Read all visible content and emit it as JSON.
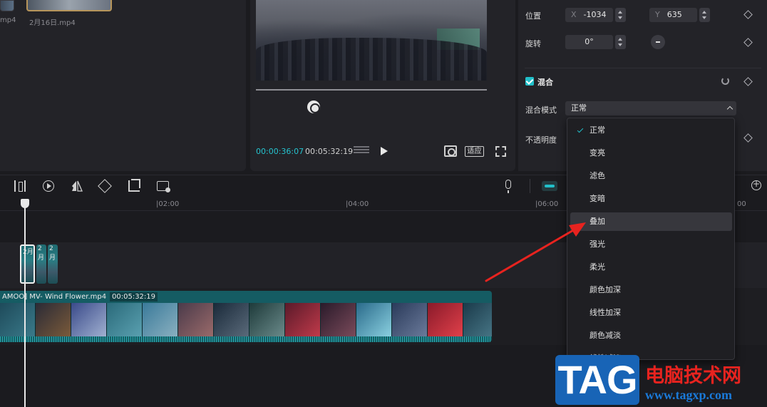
{
  "media": {
    "items": [
      {
        "label": "mp4"
      },
      {
        "label": "2月16日.mp4"
      }
    ]
  },
  "player": {
    "current_time": "00:00:36:07",
    "total_time": "00:05:32:19",
    "adapt_label": "适应"
  },
  "properties": {
    "position_label": "位置",
    "x_prefix": "X",
    "x_value": "-1034",
    "y_prefix": "Y",
    "y_value": "635",
    "rotate_label": "旋转",
    "rotate_value": "0°",
    "blend_section_label": "混合",
    "blend_mode_label": "混合模式",
    "blend_mode_value": "正常",
    "opacity_label": "不透明度"
  },
  "blend_dropdown": {
    "selected": "正常",
    "hovered": "叠加",
    "options": [
      "正常",
      "变亮",
      "滤色",
      "变暗",
      "叠加",
      "强光",
      "柔光",
      "颜色加深",
      "线性加深",
      "颜色减淡",
      "线性减淡"
    ]
  },
  "timeline": {
    "ticks": [
      "|02:00",
      "|04:00",
      "|06:00",
      "00"
    ],
    "small_clip_label": "2月",
    "main_clip_name": "AMOO] MV- Wind Flower.mp4",
    "main_clip_duration": "00:05:32:19"
  },
  "watermark": {
    "tag": "TAG",
    "site_name": "电脑技术网",
    "url": "www.tagxp.com"
  },
  "colors": {
    "accent": "#21bfc9",
    "clip": "#155c63",
    "arrow": "#e8231f"
  }
}
